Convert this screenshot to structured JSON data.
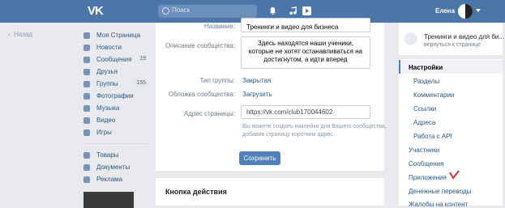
{
  "header": {
    "logo": "VK",
    "search_placeholder": "Поиск",
    "user_name": "Елена"
  },
  "back_label": "Назад",
  "sidebar": {
    "items": [
      {
        "label": "Моя Страница",
        "icon": "home-icon"
      },
      {
        "label": "Новости",
        "icon": "news-icon"
      },
      {
        "label": "Сообщения",
        "icon": "messages-icon",
        "badge": "19"
      },
      {
        "label": "Друзья",
        "icon": "friends-icon"
      },
      {
        "label": "Группы",
        "icon": "groups-icon",
        "badge": "155"
      },
      {
        "label": "Фотографии",
        "icon": "photos-icon"
      },
      {
        "label": "Музыка",
        "icon": "music-icon"
      },
      {
        "label": "Видео",
        "icon": "video-icon"
      },
      {
        "label": "Игры",
        "icon": "games-icon"
      }
    ],
    "extra": [
      {
        "label": "Товары",
        "icon": "goods-icon"
      },
      {
        "label": "Документы",
        "icon": "documents-icon"
      },
      {
        "label": "Реклама",
        "icon": "ads-icon"
      }
    ]
  },
  "form": {
    "name_label": "Название:",
    "name_value": "Тренинги и видео для бизнеса",
    "description_label": "Описание сообщества:",
    "description_value": "Здесь находятся наши ученики, которые не хотят останавливаться на достигнутом, а идти вперед",
    "type_label": "Тип группы:",
    "type_value": "Закрытая",
    "cover_label": "Обложка сообщества:",
    "cover_value": "Загрузить",
    "address_label": "Адрес страницы:",
    "address_value": "https://vk.com/club170044602",
    "address_hint": "Вы можете создать наклейки для Вашего сообщества, добавив страницу коротким адрес.",
    "save_label": "Сохранить"
  },
  "action_card": {
    "title": "Кнопка действия"
  },
  "right_panel": {
    "group_name": "Тренинги и видео для би...",
    "back_to_page": "вернуться к странице",
    "menu": [
      "Настройки",
      "Разделы",
      "Комментарии",
      "Ссылки",
      "Адреса",
      "Работа с API",
      "Участники",
      "Сообщения",
      "Приложения",
      "Денежные переводы",
      "Жалобы на контент"
    ]
  },
  "colors": {
    "header_bg": "#4a76a8",
    "accent": "#5181b8",
    "link": "#2a5885",
    "page_bg": "#e8eaed",
    "annotation_check": "#e03030"
  }
}
